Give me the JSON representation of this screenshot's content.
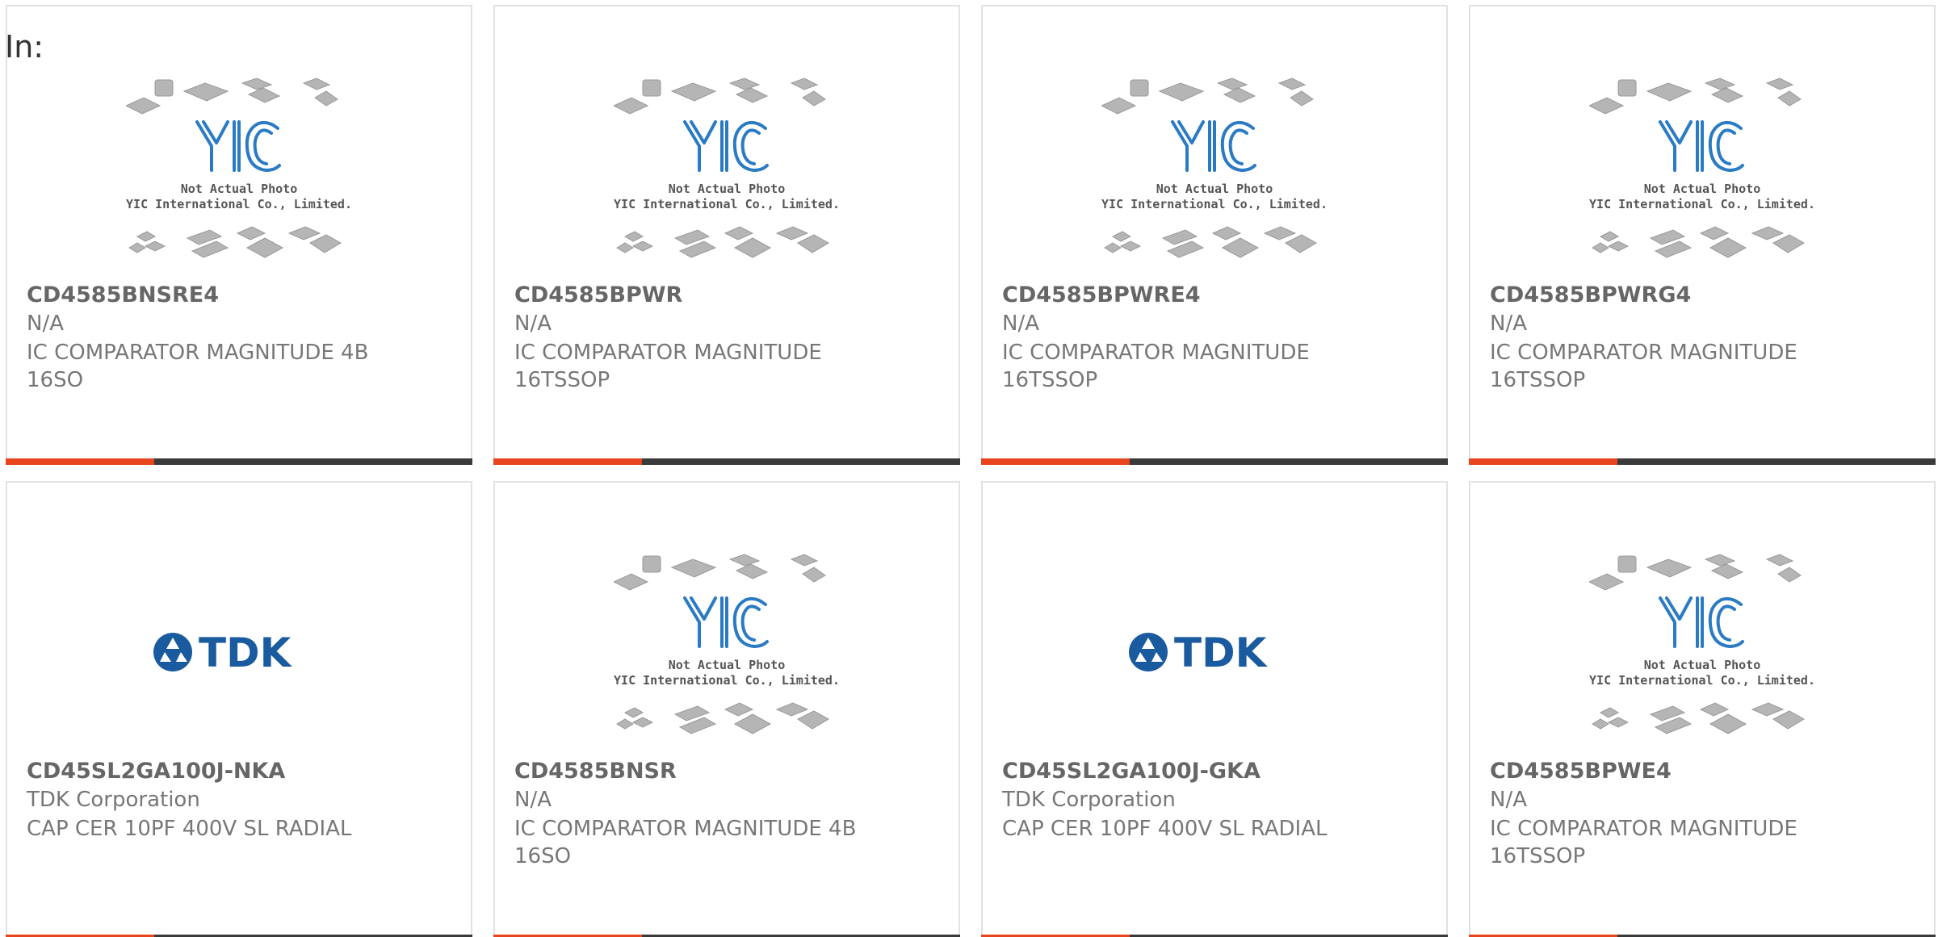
{
  "page": {
    "label": "In:"
  },
  "colors": {
    "accent": "#e8441e",
    "bar": "#3a3a3a",
    "yic_blue": "#2a7bc4",
    "tdk_blue": "#1a5a9e"
  },
  "placeholder": {
    "line1": "Not Actual Photo",
    "line2": "YIC International Co., Limited.",
    "logo": "YIC"
  },
  "tdk_logo": {
    "text": "TDK"
  },
  "products": [
    {
      "part": "CD4585BNSRE4",
      "manufacturer": "N/A",
      "description": "IC COMPARATOR MAGNITUDE 4B 16SO",
      "image": "yic-placeholder"
    },
    {
      "part": "CD4585BPWR",
      "manufacturer": "N/A",
      "description": "IC COMPARATOR MAGNITUDE 16TSSOP",
      "image": "yic-placeholder"
    },
    {
      "part": "CD4585BPWRE4",
      "manufacturer": "N/A",
      "description": "IC COMPARATOR MAGNITUDE 16TSSOP",
      "image": "yic-placeholder"
    },
    {
      "part": "CD4585BPWRG4",
      "manufacturer": "N/A",
      "description": "IC COMPARATOR MAGNITUDE 16TSSOP",
      "image": "yic-placeholder"
    },
    {
      "part": "CD45SL2GA100J-NKA",
      "manufacturer": "TDK Corporation",
      "description": "CAP CER 10PF 400V SL RADIAL",
      "image": "tdk-logo"
    },
    {
      "part": "CD4585BNSR",
      "manufacturer": "N/A",
      "description": "IC COMPARATOR MAGNITUDE 4B 16SO",
      "image": "yic-placeholder"
    },
    {
      "part": "CD45SL2GA100J-GKA",
      "manufacturer": "TDK Corporation",
      "description": "CAP CER 10PF 400V SL RADIAL",
      "image": "tdk-logo"
    },
    {
      "part": "CD4585BPWE4",
      "manufacturer": "N/A",
      "description": "IC COMPARATOR MAGNITUDE 16TSSOP",
      "image": "yic-placeholder"
    }
  ]
}
